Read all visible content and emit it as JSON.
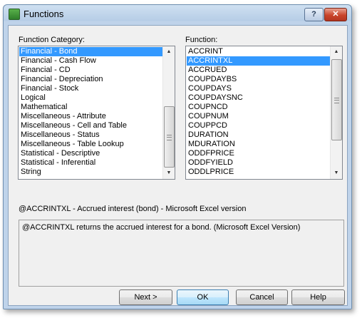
{
  "window": {
    "title": "Functions",
    "help_glyph": "?",
    "close_glyph": "✕"
  },
  "category_panel": {
    "label": "Function Category:",
    "selected_index": 0,
    "items": [
      "Financial - Bond",
      "Financial - Cash Flow",
      "Financial - CD",
      "Financial - Depreciation",
      "Financial - Stock",
      "Logical",
      "Mathematical",
      "Miscellaneous - Attribute",
      "Miscellaneous - Cell and Table",
      "Miscellaneous - Status",
      "Miscellaneous - Table Lookup",
      "Statistical - Descriptive",
      "Statistical - Inferential",
      "String"
    ]
  },
  "function_panel": {
    "label": "Function:",
    "selected_index": 1,
    "items": [
      "ACCRINT",
      "ACCRINTXL",
      "ACCRUED",
      "COUPDAYBS",
      "COUPDAYS",
      "COUPDAYSNC",
      "COUPNCD",
      "COUPNUM",
      "COUPPCD",
      "DURATION",
      "MDURATION",
      "ODDFPRICE",
      "ODDFYIELD",
      "ODDLPRICE"
    ]
  },
  "syntax_text": "@ACCRINTXL - Accrued interest (bond) - Microsoft Excel version",
  "description_text": "@ACCRINTXL returns the accrued interest for a bond. (Microsoft Excel Version)",
  "buttons": {
    "next": "Next >",
    "ok": "OK",
    "cancel": "Cancel",
    "help": "Help"
  },
  "scroll_glyphs": {
    "up": "▲",
    "down": "▼"
  }
}
